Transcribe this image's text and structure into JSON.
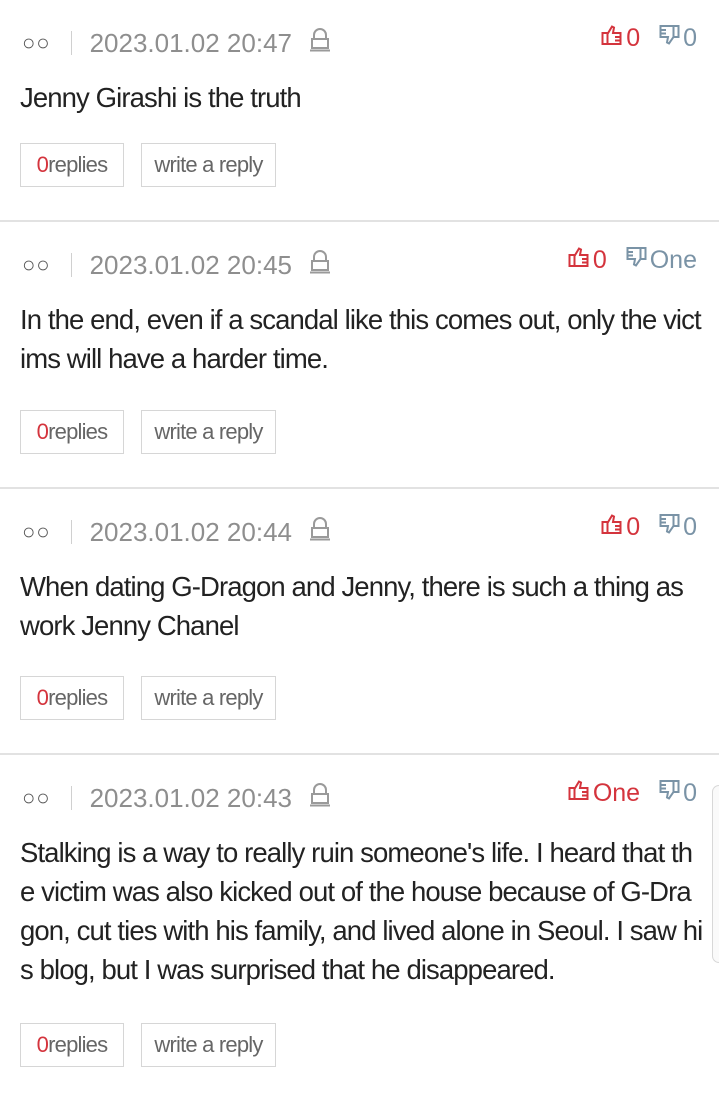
{
  "comments": [
    {
      "nickname": "○○",
      "date": "2023.01.02 20:47",
      "likes": "0",
      "dislikes": "0",
      "text": "Jenny Girashi is the truth",
      "replies_count": "0",
      "replies_label": "replies",
      "write_label": "write a reply"
    },
    {
      "nickname": "○○",
      "date": "2023.01.02 20:45",
      "likes": "0",
      "dislikes": "One",
      "text": "In the end, even if a scandal like this comes out, only the victims will have a harder time.",
      "replies_count": "0",
      "replies_label": "replies",
      "write_label": "write a reply"
    },
    {
      "nickname": "○○",
      "date": "2023.01.02 20:44",
      "likes": "0",
      "dislikes": "0",
      "text": "When dating G-Dragon and Jenny, there is such a thing as work Jenny Chanel",
      "replies_count": "0",
      "replies_label": "replies",
      "write_label": "write a reply"
    },
    {
      "nickname": "○○",
      "date": "2023.01.02 20:43",
      "likes": "One",
      "dislikes": "0",
      "text": "Stalking is a way to really ruin someone's life. I heard that the victim was also kicked out of the house because of G-Dragon, cut ties with his family, and lived alone in Seoul. I saw his blog, but I was surprised that he disappeared.",
      "replies_count": "0",
      "replies_label": "replies",
      "write_label": "write a reply"
    }
  ],
  "icons": {
    "lock": "lock-icon",
    "thumbs_up": "thumbs-up-icon",
    "thumbs_down": "thumbs-down-icon"
  },
  "colors": {
    "accent_red": "#d4343d",
    "dislike_gray": "#7a93a6",
    "divider": "#e2e2e2"
  }
}
